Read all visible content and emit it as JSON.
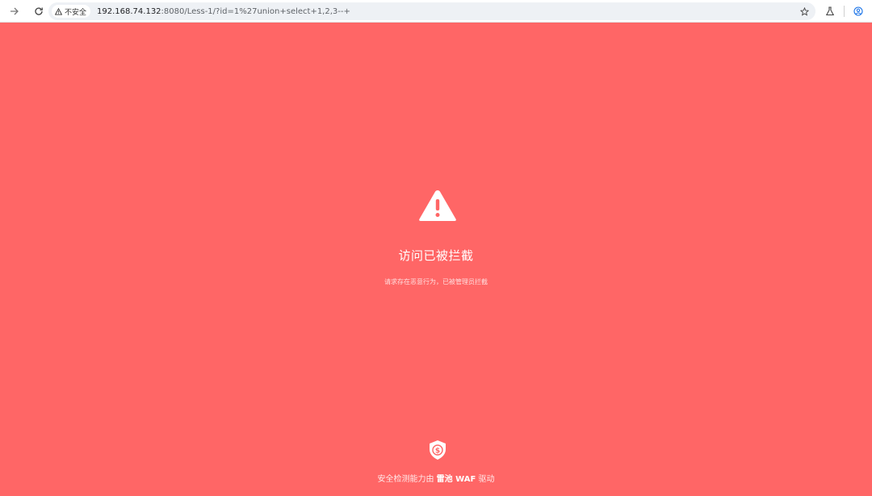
{
  "browser": {
    "back_icon": "arrow-right-icon",
    "reload_icon": "reload-icon",
    "security_chip": "不安全",
    "url_host": "192.168.74.132",
    "url_rest": ":8080/Less-1/?id=1%27union+select+1,2,3--+",
    "star_icon": "star-icon",
    "labs_icon": "flask-icon",
    "profile_icon": "account-icon"
  },
  "block_page": {
    "background": "#ff6666",
    "icon": "warning-triangle-icon",
    "title": "访问已被拦截",
    "subtitle": "请求存在恶意行为，已被管理员拦截",
    "shield_icon": "shield-dollar-icon",
    "footer_prefix": "安全检测能力由",
    "footer_brand": "雷池 WAF",
    "footer_suffix": "驱动"
  }
}
